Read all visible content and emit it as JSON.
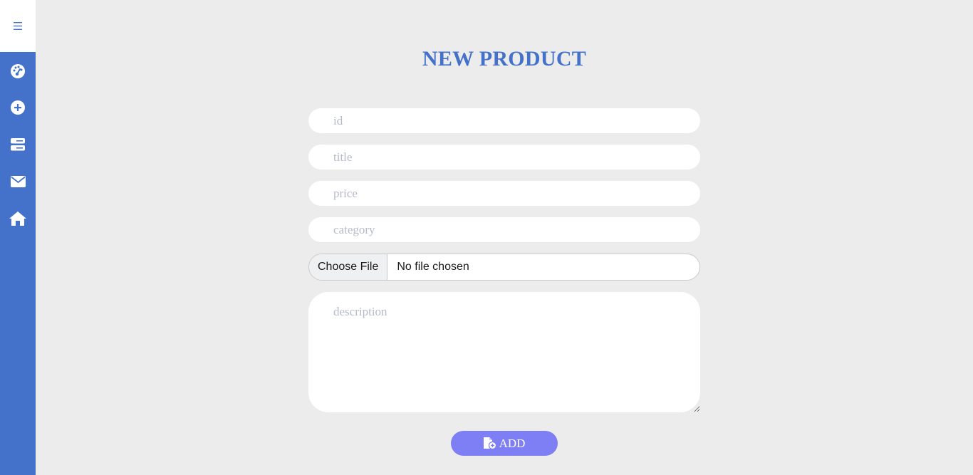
{
  "sidebar": {
    "toggle_icon": "hamburger-menu-icon",
    "items": [
      {
        "icon": "dashboard-gauge-icon"
      },
      {
        "icon": "add-circle-icon"
      },
      {
        "icon": "server-list-icon"
      },
      {
        "icon": "envelope-icon"
      },
      {
        "icon": "home-icon"
      }
    ],
    "color": "#4472ca"
  },
  "form": {
    "title": "NEW PRODUCT",
    "fields": {
      "id": {
        "placeholder": "id",
        "value": ""
      },
      "title": {
        "placeholder": "title",
        "value": ""
      },
      "price": {
        "placeholder": "price",
        "value": ""
      },
      "category": {
        "placeholder": "category",
        "value": ""
      },
      "description": {
        "placeholder": "description",
        "value": ""
      }
    },
    "file": {
      "button_label": "Choose File",
      "status": "No file chosen"
    },
    "submit": {
      "label": "ADD",
      "icon": "file-add-icon",
      "color": "#7f7ff5"
    }
  },
  "colors": {
    "background": "#ececec",
    "accent": "#4472ca"
  }
}
